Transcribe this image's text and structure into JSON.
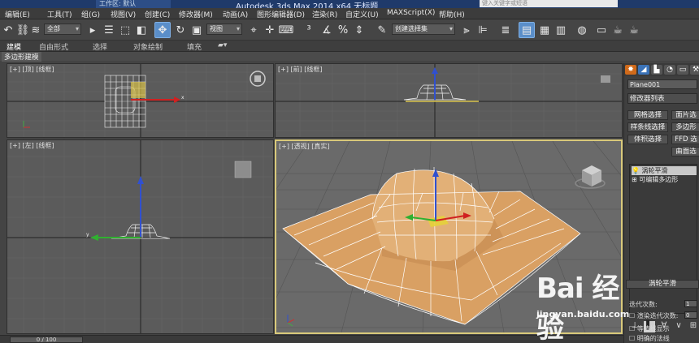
{
  "titlebar": {
    "workspace": "工作区: 默认",
    "app_title": "Autodesk 3ds Max  2014 x64    无标题",
    "help_search": "键入关键字或短语"
  },
  "menu": [
    "编辑(E)",
    "工具(T)",
    "组(G)",
    "视图(V)",
    "创建(C)",
    "修改器(M)",
    "动画(A)",
    "图形编辑器(D)",
    "渲染(R)",
    "自定义(U)",
    "MAXScript(X)",
    "帮助(H)"
  ],
  "toolbar": {
    "selection_filter": "全部",
    "ref_coord": "视图",
    "named_selection": "创建选择集"
  },
  "ribbon": {
    "tabs": [
      "建模",
      "自由形式",
      "选择",
      "对象绘制",
      "填充"
    ],
    "subtab": "多边形建模"
  },
  "viewports": {
    "top": "[+] [顶] [线框]",
    "front": "[+] [前] [线框]",
    "left": "[+] [左] [线框]",
    "perspective": "[+] [透视] [真实]"
  },
  "command_panel": {
    "object_name": "Plane001",
    "modifier_list": "修改器列表",
    "buttons": [
      "网格选择",
      "面片选",
      "样条线选择",
      "多边形",
      "体积选择",
      "FFD 选",
      "曲面选"
    ],
    "stack": [
      "涡轮平滑",
      "可编辑多边形"
    ]
  },
  "rollout": {
    "title": "涡轮平滑",
    "iterations_label": "迭代次数:",
    "iterations_value": "1",
    "render_iters_label": "渲染迭代次数:",
    "render_iters_value": "0",
    "isoline_label": "等值线显示",
    "explicit_normals_label": "明确的法线"
  },
  "timeline": {
    "frame": "0 / 100"
  },
  "watermark": {
    "logo": "Bai 经验",
    "url": "jingyan.baidu.com"
  },
  "colors": {
    "accent": "#5a8ec9",
    "surface": "#d9a063",
    "wire": "#ffffff",
    "active_viewport_border": "#d9c97a"
  }
}
